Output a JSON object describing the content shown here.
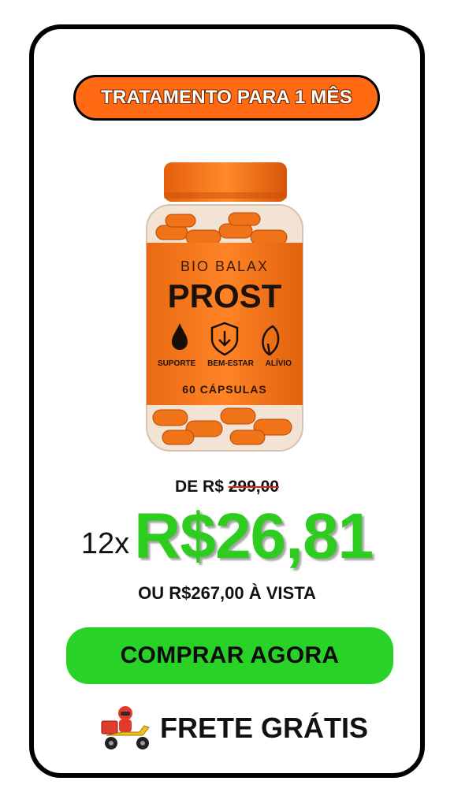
{
  "badge": {
    "label": "TRATAMENTO PARA 1 MÊS",
    "color": "#ff6a13"
  },
  "product": {
    "brand": "BIO BALAX",
    "name": "PROST",
    "benefits": [
      "SUPORTE",
      "BEM-ESTAR",
      "ALÍVIO"
    ],
    "capsules": "60 CÁPSULAS",
    "icons": [
      "drop-icon",
      "shield-arrow-icon",
      "leaf-icon"
    ]
  },
  "pricing": {
    "old_prefix": "DE R$",
    "old_value": "299,00",
    "installments": "12x",
    "price": "R$26,81",
    "cash": "OU  R$267,00 À VISTA",
    "price_color": "#2ecc1f",
    "strike_color": "#e3201b"
  },
  "cta": {
    "label": "COMPRAR AGORA",
    "color": "#29d226"
  },
  "shipping": {
    "label": "FRETE GRÁTIS",
    "icon": "delivery-scooter-icon"
  }
}
